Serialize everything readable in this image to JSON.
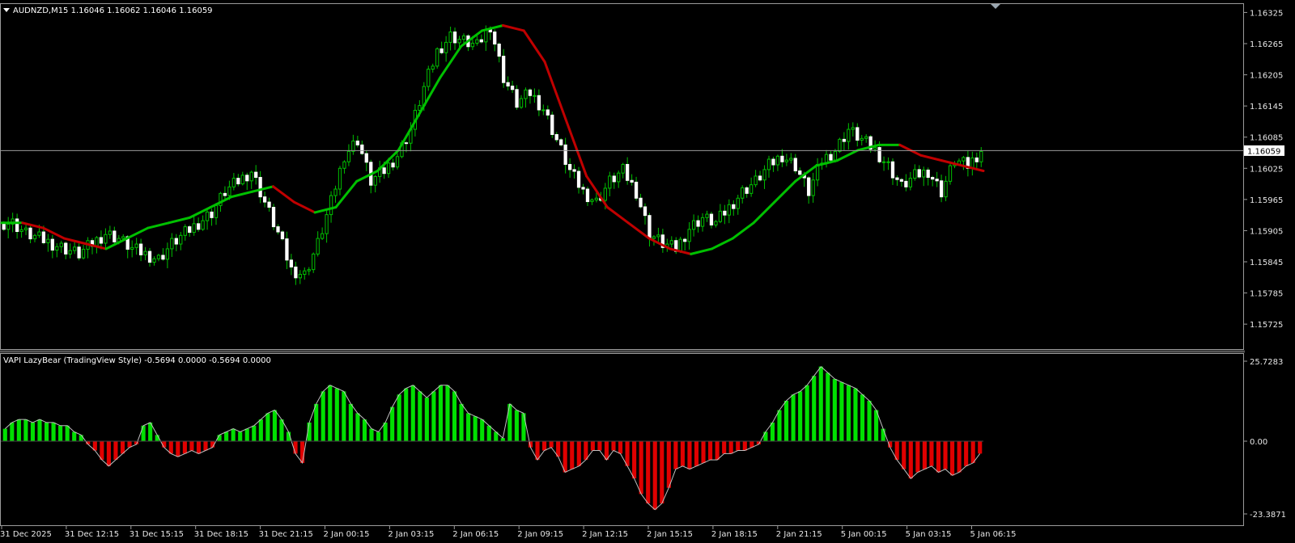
{
  "colors": {
    "background": "#000000",
    "grid_frame": "#9a9a9a",
    "bull_candle": "#ffffff",
    "bear_candle": "#ffffff",
    "wick": "#00c000",
    "ma_up": "#00c000",
    "ma_down": "#c00000",
    "hist_pos": "#00e000",
    "hist_neg": "#e00000",
    "hist_outline": "#c0c0c0",
    "price_line": "#9a9a9a"
  },
  "main_window": {
    "title": "AUDNZD,M15  1.16046 1.16062 1.16046 1.16059",
    "collapse_icon": "triangle-down-icon",
    "current_price": "1.16059",
    "y_ticks": [
      "1.16325",
      "1.16265",
      "1.16205",
      "1.16145",
      "1.16085",
      "1.16025",
      "1.15965",
      "1.15905",
      "1.15845",
      "1.15785",
      "1.15725"
    ]
  },
  "sub_window": {
    "title": "VAPI LazyBear (TradingView Style) -0.5694 0.0000 -0.5694 0.0000",
    "y_ticks": [
      "25.7283",
      "0.00",
      "-23.3871"
    ]
  },
  "x_ticks": [
    "31 Dec 2025",
    "31 Dec 12:15",
    "31 Dec 15:15",
    "31 Dec 18:15",
    "31 Dec 21:15",
    "2 Jan 00:15",
    "2 Jan 03:15",
    "2 Jan 06:15",
    "2 Jan 09:15",
    "2 Jan 12:15",
    "2 Jan 15:15",
    "2 Jan 18:15",
    "2 Jan 21:15",
    "5 Jan 00:15",
    "5 Jan 03:15",
    "5 Jan 06:15"
  ],
  "chart_data": [
    {
      "type": "candlestick",
      "title": "AUDNZD,M15",
      "ylim": [
        1.15705,
        1.16335
      ],
      "close_series_approx": [
        1.1592,
        1.159,
        1.1589,
        1.1588,
        1.1587,
        1.1586,
        1.1588,
        1.159,
        1.1589,
        1.1587,
        1.1586,
        1.1585,
        1.1588,
        1.159,
        1.1592,
        1.1594,
        1.1598,
        1.16,
        1.1602,
        1.1596,
        1.159,
        1.1583,
        1.1582,
        1.1588,
        1.1596,
        1.1605,
        1.1608,
        1.16,
        1.1602,
        1.1605,
        1.161,
        1.1618,
        1.1625,
        1.1628,
        1.1627,
        1.1626,
        1.163,
        1.162,
        1.1615,
        1.1617,
        1.1614,
        1.1608,
        1.1602,
        1.1598,
        1.1596,
        1.16,
        1.1602,
        1.1598,
        1.159,
        1.1588,
        1.1587,
        1.1591,
        1.1593,
        1.1592,
        1.1595,
        1.1598,
        1.16,
        1.1603,
        1.1605,
        1.1603,
        1.1598,
        1.1604,
        1.1606,
        1.161,
        1.1608,
        1.1606,
        1.1603,
        1.1599,
        1.1601,
        1.1602,
        1.1598,
        1.1604,
        1.1603,
        1.1606
      ]
    },
    {
      "type": "line",
      "name": "",
      "values": [
        1.1592,
        1.1592,
        1.1591,
        1.1589,
        1.1588,
        1.1587,
        1.1589,
        1.1591,
        1.1592,
        1.1593,
        1.1595,
        1.1597,
        1.1598,
        1.1599,
        1.1596,
        1.1594,
        1.1595,
        1.16,
        1.1602,
        1.1606,
        1.1613,
        1.162,
        1.1626,
        1.1629,
        1.163,
        1.1629,
        1.1623,
        1.1612,
        1.1601,
        1.1595,
        1.1592,
        1.1589,
        1.1587,
        1.1586,
        1.1587,
        1.1589,
        1.1592,
        1.1596,
        1.16,
        1.1603,
        1.1604,
        1.1606,
        1.1607,
        1.1607,
        1.1605,
        1.1604,
        1.1603,
        1.1602
      ]
    },
    {
      "type": "bar",
      "title": "VAPI LazyBear (TradingView Style)",
      "ylim": [
        -23.3871,
        25.7283
      ],
      "values": [
        4,
        6,
        7,
        7,
        6,
        7,
        6,
        6,
        5,
        5,
        3,
        2,
        -1,
        -3,
        -6,
        -8,
        -6,
        -4,
        -2,
        -1,
        5,
        6,
        2,
        -2,
        -4,
        -5,
        -4,
        -3,
        -4,
        -3,
        -2,
        2,
        3,
        4,
        3,
        4,
        5,
        7,
        9,
        10,
        7,
        3,
        -4,
        -7,
        6,
        12,
        16,
        18,
        17,
        16,
        12,
        9,
        7,
        4,
        3,
        6,
        11,
        15,
        17,
        18,
        16,
        14,
        16,
        18,
        18,
        16,
        12,
        9,
        8,
        7,
        5,
        3,
        1,
        12,
        10,
        9,
        -2,
        -6,
        -3,
        -2,
        -5,
        -10,
        -9,
        -8,
        -6,
        -3,
        -3,
        -6,
        -3,
        -4,
        -8,
        -12,
        -17,
        -20,
        -22,
        -20,
        -15,
        -9,
        -8,
        -9,
        -8,
        -7,
        -6,
        -6,
        -4,
        -4,
        -3,
        -3,
        -2,
        -1,
        3,
        6,
        10,
        13,
        15,
        16,
        18,
        21,
        24,
        22,
        20,
        19,
        18,
        17,
        15,
        13,
        10,
        4,
        -2,
        -6,
        -9,
        -12,
        -10,
        -9,
        -8,
        -10,
        -9,
        -11,
        -10,
        -8,
        -7,
        -4
      ]
    }
  ]
}
